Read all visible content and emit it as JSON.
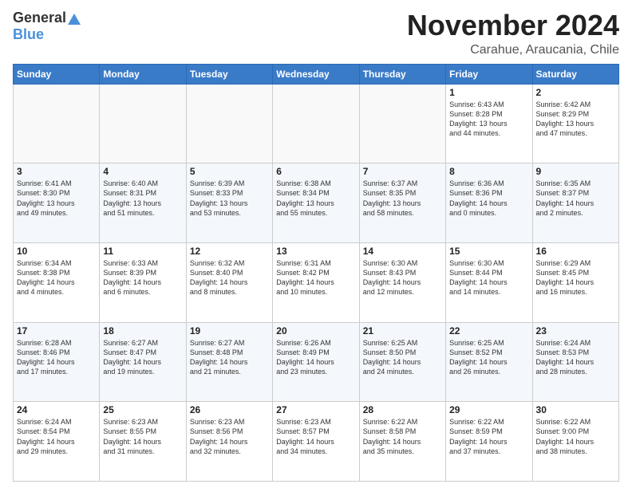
{
  "header": {
    "logo_general": "General",
    "logo_blue": "Blue",
    "month_title": "November 2024",
    "location": "Carahue, Araucania, Chile"
  },
  "calendar": {
    "days_of_week": [
      "Sunday",
      "Monday",
      "Tuesday",
      "Wednesday",
      "Thursday",
      "Friday",
      "Saturday"
    ],
    "weeks": [
      [
        {
          "day": "",
          "info": ""
        },
        {
          "day": "",
          "info": ""
        },
        {
          "day": "",
          "info": ""
        },
        {
          "day": "",
          "info": ""
        },
        {
          "day": "",
          "info": ""
        },
        {
          "day": "1",
          "info": "Sunrise: 6:43 AM\nSunset: 8:28 PM\nDaylight: 13 hours\nand 44 minutes."
        },
        {
          "day": "2",
          "info": "Sunrise: 6:42 AM\nSunset: 8:29 PM\nDaylight: 13 hours\nand 47 minutes."
        }
      ],
      [
        {
          "day": "3",
          "info": "Sunrise: 6:41 AM\nSunset: 8:30 PM\nDaylight: 13 hours\nand 49 minutes."
        },
        {
          "day": "4",
          "info": "Sunrise: 6:40 AM\nSunset: 8:31 PM\nDaylight: 13 hours\nand 51 minutes."
        },
        {
          "day": "5",
          "info": "Sunrise: 6:39 AM\nSunset: 8:33 PM\nDaylight: 13 hours\nand 53 minutes."
        },
        {
          "day": "6",
          "info": "Sunrise: 6:38 AM\nSunset: 8:34 PM\nDaylight: 13 hours\nand 55 minutes."
        },
        {
          "day": "7",
          "info": "Sunrise: 6:37 AM\nSunset: 8:35 PM\nDaylight: 13 hours\nand 58 minutes."
        },
        {
          "day": "8",
          "info": "Sunrise: 6:36 AM\nSunset: 8:36 PM\nDaylight: 14 hours\nand 0 minutes."
        },
        {
          "day": "9",
          "info": "Sunrise: 6:35 AM\nSunset: 8:37 PM\nDaylight: 14 hours\nand 2 minutes."
        }
      ],
      [
        {
          "day": "10",
          "info": "Sunrise: 6:34 AM\nSunset: 8:38 PM\nDaylight: 14 hours\nand 4 minutes."
        },
        {
          "day": "11",
          "info": "Sunrise: 6:33 AM\nSunset: 8:39 PM\nDaylight: 14 hours\nand 6 minutes."
        },
        {
          "day": "12",
          "info": "Sunrise: 6:32 AM\nSunset: 8:40 PM\nDaylight: 14 hours\nand 8 minutes."
        },
        {
          "day": "13",
          "info": "Sunrise: 6:31 AM\nSunset: 8:42 PM\nDaylight: 14 hours\nand 10 minutes."
        },
        {
          "day": "14",
          "info": "Sunrise: 6:30 AM\nSunset: 8:43 PM\nDaylight: 14 hours\nand 12 minutes."
        },
        {
          "day": "15",
          "info": "Sunrise: 6:30 AM\nSunset: 8:44 PM\nDaylight: 14 hours\nand 14 minutes."
        },
        {
          "day": "16",
          "info": "Sunrise: 6:29 AM\nSunset: 8:45 PM\nDaylight: 14 hours\nand 16 minutes."
        }
      ],
      [
        {
          "day": "17",
          "info": "Sunrise: 6:28 AM\nSunset: 8:46 PM\nDaylight: 14 hours\nand 17 minutes."
        },
        {
          "day": "18",
          "info": "Sunrise: 6:27 AM\nSunset: 8:47 PM\nDaylight: 14 hours\nand 19 minutes."
        },
        {
          "day": "19",
          "info": "Sunrise: 6:27 AM\nSunset: 8:48 PM\nDaylight: 14 hours\nand 21 minutes."
        },
        {
          "day": "20",
          "info": "Sunrise: 6:26 AM\nSunset: 8:49 PM\nDaylight: 14 hours\nand 23 minutes."
        },
        {
          "day": "21",
          "info": "Sunrise: 6:25 AM\nSunset: 8:50 PM\nDaylight: 14 hours\nand 24 minutes."
        },
        {
          "day": "22",
          "info": "Sunrise: 6:25 AM\nSunset: 8:52 PM\nDaylight: 14 hours\nand 26 minutes."
        },
        {
          "day": "23",
          "info": "Sunrise: 6:24 AM\nSunset: 8:53 PM\nDaylight: 14 hours\nand 28 minutes."
        }
      ],
      [
        {
          "day": "24",
          "info": "Sunrise: 6:24 AM\nSunset: 8:54 PM\nDaylight: 14 hours\nand 29 minutes."
        },
        {
          "day": "25",
          "info": "Sunrise: 6:23 AM\nSunset: 8:55 PM\nDaylight: 14 hours\nand 31 minutes."
        },
        {
          "day": "26",
          "info": "Sunrise: 6:23 AM\nSunset: 8:56 PM\nDaylight: 14 hours\nand 32 minutes."
        },
        {
          "day": "27",
          "info": "Sunrise: 6:23 AM\nSunset: 8:57 PM\nDaylight: 14 hours\nand 34 minutes."
        },
        {
          "day": "28",
          "info": "Sunrise: 6:22 AM\nSunset: 8:58 PM\nDaylight: 14 hours\nand 35 minutes."
        },
        {
          "day": "29",
          "info": "Sunrise: 6:22 AM\nSunset: 8:59 PM\nDaylight: 14 hours\nand 37 minutes."
        },
        {
          "day": "30",
          "info": "Sunrise: 6:22 AM\nSunset: 9:00 PM\nDaylight: 14 hours\nand 38 minutes."
        }
      ]
    ]
  }
}
